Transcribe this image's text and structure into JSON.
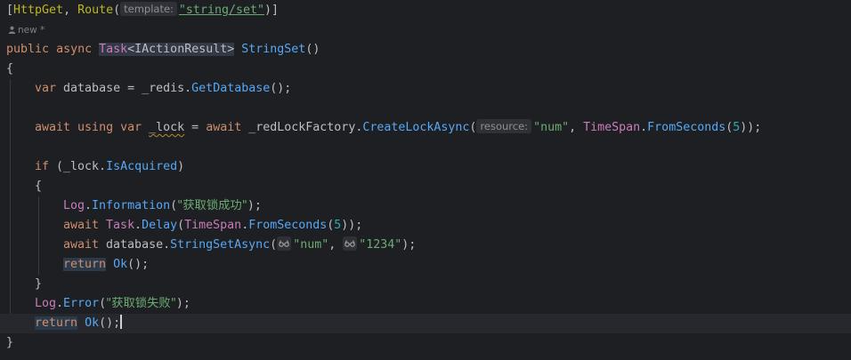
{
  "code": {
    "attr_open": "[",
    "attr_httpget": "HttpGet",
    "attr_sep": ", ",
    "attr_route": "Route",
    "attr_paren_open": "(",
    "hint_template": "template:",
    "route_value": "\"string/set\"",
    "attr_close": ")]",
    "lens_author": "new *",
    "kw_public": "public",
    "kw_async": "async",
    "ret_task": "Task",
    "ret_generic_open": "<",
    "ret_iaction": "IActionResult",
    "ret_generic_close": ">",
    "method_name": "StringSet",
    "method_parens": "()",
    "brace_open": "{",
    "kw_var1": "var",
    "line5_db": " database = ",
    "line5_redis": "_redis",
    "line5_dot": ".",
    "line5_getdb": "GetDatabase",
    "line5_end": "();",
    "kw_await1": "await",
    "kw_using": "using",
    "kw_var2": "var",
    "lock_var": "_lock",
    "line7_eq": " = ",
    "kw_await2": "await",
    "line7_factory": " _redLockFactory.",
    "line7_create": "CreateLockAsync",
    "line7_paren": "(",
    "hint_resource": "resource:",
    "line7_num_str": "\"num\"",
    "line7_comma": ", ",
    "line7_timespan": "TimeSpan",
    "line7_dot": ".",
    "line7_fromsec": "FromSeconds",
    "line7_paren2": "(",
    "line7_five": "5",
    "line7_end": "));",
    "kw_if": "if",
    "line9_open": " (_lock.",
    "line9_acquired": "IsAcquired",
    "line9_close": ")",
    "brace_open2": "{",
    "log1_log": "Log",
    "log1_dot": ".",
    "log1_info": "Information",
    "log1_paren": "(",
    "log1_msg": "\"获取锁成功\"",
    "log1_end": ");",
    "kw_await3": "await",
    "line12_task": "Task",
    "line12_dot": ".",
    "line12_delay": "Delay",
    "line12_paren": "(",
    "line12_timespan": "TimeSpan",
    "line12_dot2": ".",
    "line12_fromsec": "FromSeconds",
    "line12_paren2": "(",
    "line12_five": "5",
    "line12_end": "));",
    "kw_await4": "await",
    "line13_db": " database.",
    "line13_method": "StringSetAsync",
    "line13_paren": "(",
    "line13_num": "\"num\"",
    "line13_comma": ", ",
    "line13_val": "\"1234\"",
    "line13_end": ");",
    "kw_return1": "return",
    "line14_ok": "Ok",
    "line14_end": "();",
    "brace_close2": "}",
    "log2_log": "Log",
    "log2_dot": ".",
    "log2_error": "Error",
    "log2_paren": "(",
    "log2_msg": "\"获取锁失败\"",
    "log2_end": ");",
    "kw_return2": "return",
    "line17_ok": "Ok",
    "line17_end": "();",
    "brace_close": "}"
  },
  "icons": {
    "author_icon": "person-icon",
    "param_hint_icon": "glasses-icon"
  },
  "colors": {
    "background": "#1e1f22",
    "keyword": "#cf8e6d",
    "method": "#56a8f5",
    "string": "#6aab73",
    "number": "#2aacb8",
    "class": "#c77dbb",
    "attribute": "#bbb529"
  }
}
